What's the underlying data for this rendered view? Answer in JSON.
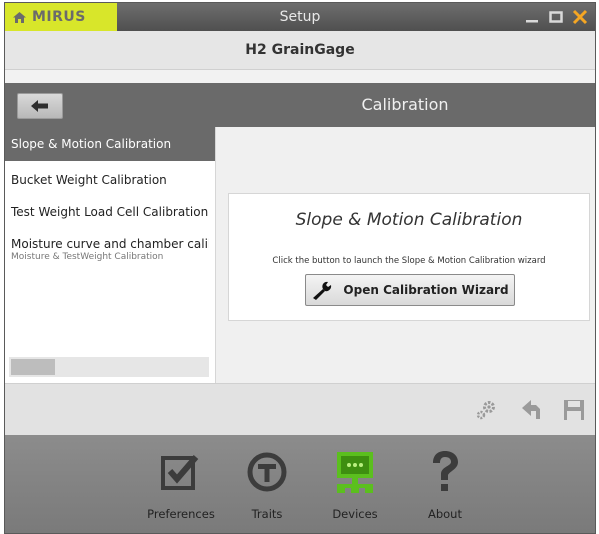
{
  "window": {
    "brand": "MIRUS",
    "title": "Setup"
  },
  "app": {
    "title": "H2 GrainGage"
  },
  "section": {
    "title": "Calibration"
  },
  "sidebar": {
    "items": [
      {
        "label": "Slope & Motion Calibration",
        "selected": true
      },
      {
        "label": "Bucket Weight Calibration"
      },
      {
        "label": "Test Weight Load Cell Calibration"
      },
      {
        "label": "Moisture curve and chamber calib",
        "sublabel": "Moisture & TestWeight Calibration"
      }
    ]
  },
  "main": {
    "card_title": "Slope & Motion Calibration",
    "description": "Click the button to launch the Slope & Motion Calibration wizard",
    "button_label": "Open Calibration Wizard"
  },
  "toolbar": {
    "icons": [
      "gears-icon",
      "undo-arrow-icon",
      "save-icon"
    ]
  },
  "nav": {
    "items": [
      {
        "label": "Preferences",
        "icon": "checkbox-icon"
      },
      {
        "label": "Traits",
        "icon": "traits-t-icon"
      },
      {
        "label": "Devices",
        "icon": "devices-icon",
        "active": true
      },
      {
        "label": "About",
        "icon": "question-mark-icon"
      }
    ]
  },
  "colors": {
    "brand_accent": "#d8e62a",
    "close_button": "#f5a623",
    "devices_active": "#5bbf1e",
    "header_gray": "#6a6a6a"
  }
}
